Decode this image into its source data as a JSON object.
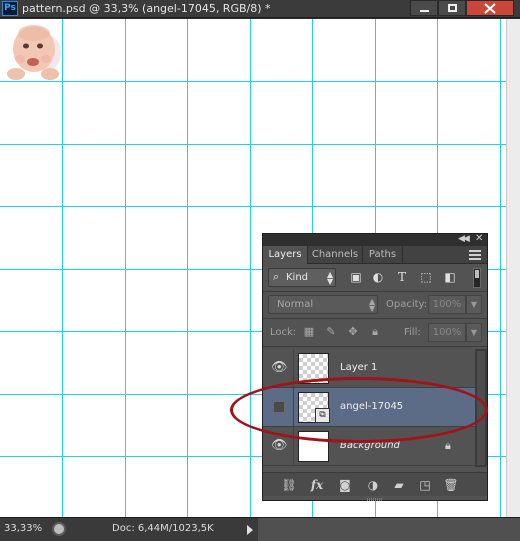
{
  "window": {
    "title": "pattern.psd @ 33,3% (angel-17045, RGB/8) *",
    "app_badge": "Ps"
  },
  "status": {
    "zoom": "33,33%",
    "doc_size": "Doc: 6,44M/1023,5K"
  },
  "layers_panel": {
    "tabs": [
      "Layers",
      "Channels",
      "Paths"
    ],
    "active_tab": "Layers",
    "filter": {
      "kind_label": "Kind"
    },
    "blend_mode": "Normal",
    "opacity_label": "Opacity:",
    "opacity_value": "100%",
    "lock_label": "Lock:",
    "fill_label": "Fill:",
    "fill_value": "100%",
    "layers": [
      {
        "name": "Layer 1",
        "visible": true,
        "selected": false
      },
      {
        "name": "angel-17045",
        "visible": false,
        "selected": true,
        "smart_object": true
      },
      {
        "name": "Background",
        "visible": true,
        "selected": false,
        "locked": true
      }
    ],
    "footer_buttons": [
      "link-icon",
      "fx-icon",
      "mask-icon",
      "adjustment-icon",
      "folder-icon",
      "new-layer-icon",
      "trash-icon"
    ]
  },
  "colors": {
    "guide": "#1fd3e0",
    "annotation": "#a0131a",
    "selected_layer": "#5c6b86"
  }
}
